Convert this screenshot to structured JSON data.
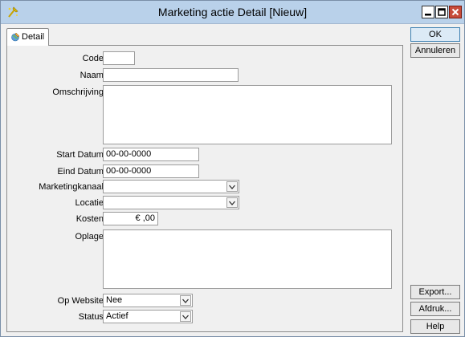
{
  "window": {
    "title": "Marketing actie Detail [Nieuw]"
  },
  "tabs": [
    {
      "label": "Detail",
      "icon": "globe-pencil-icon"
    }
  ],
  "form": {
    "code": {
      "label": "Code:",
      "value": ""
    },
    "naam": {
      "label": "Naam:",
      "value": ""
    },
    "omschrijving": {
      "label": "Omschrijving:",
      "value": ""
    },
    "start_datum": {
      "label": "Start Datum:",
      "value": "00-00-0000"
    },
    "eind_datum": {
      "label": "Eind Datum:",
      "value": "00-00-0000"
    },
    "marketingkanaal": {
      "label": "Marketingkanaal:",
      "value": ""
    },
    "locatie": {
      "label": "Locatie:",
      "value": ""
    },
    "kosten": {
      "label": "Kosten:",
      "value": "€ ,00"
    },
    "oplage": {
      "label": "Oplage:",
      "value": ""
    },
    "op_website": {
      "label": "Op Website:",
      "value": "Nee"
    },
    "status": {
      "label": "Status:",
      "value": "Actief"
    }
  },
  "buttons": {
    "ok": "OK",
    "annuleren": "Annuleren",
    "export": "Export...",
    "afdruk": "Afdruk...",
    "help": "Help"
  }
}
